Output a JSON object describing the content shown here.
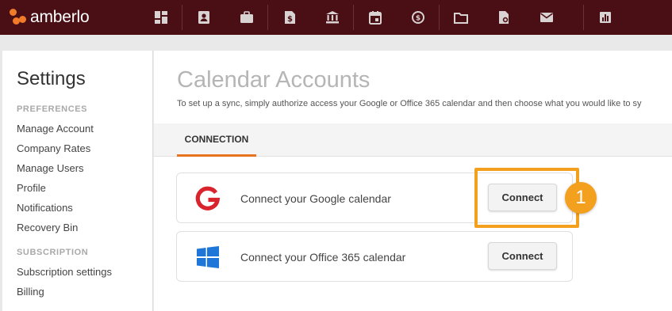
{
  "app": {
    "name": "amberlo"
  },
  "nav": [
    {
      "icon": "dashboard-icon"
    },
    {
      "icon": "contacts-icon"
    },
    {
      "icon": "matters-icon"
    },
    {
      "icon": "billing-icon"
    },
    {
      "icon": "bank-icon"
    },
    {
      "icon": "calendar-icon"
    },
    {
      "icon": "time-tracking-icon"
    },
    {
      "icon": "folder-icon"
    },
    {
      "icon": "document-icon"
    },
    {
      "icon": "mail-icon"
    },
    {
      "icon": "reports-icon"
    }
  ],
  "sidebar": {
    "title": "Settings",
    "preferences_label": "PREFERENCES",
    "preferences": [
      {
        "label": "Manage Account"
      },
      {
        "label": "Company Rates"
      },
      {
        "label": "Manage Users"
      },
      {
        "label": "Profile"
      },
      {
        "label": "Notifications"
      },
      {
        "label": "Recovery Bin"
      }
    ],
    "subscription_label": "SUBSCRIPTION",
    "subscription": [
      {
        "label": "Subscription settings"
      },
      {
        "label": "Billing"
      }
    ]
  },
  "main": {
    "title": "Calendar Accounts",
    "subtitle": "To set up a sync, simply authorize access your Google or Office 365 calendar and then choose what you would like to sy",
    "tab": "CONNECTION",
    "accounts": [
      {
        "icon": "google-icon",
        "text": "Connect your Google calendar",
        "button": "Connect"
      },
      {
        "icon": "windows-icon",
        "text": "Connect your Office 365 calendar",
        "button": "Connect"
      }
    ]
  },
  "annotation": {
    "step": "1"
  },
  "colors": {
    "topbar": "#4a0f14",
    "accent": "#e8731f",
    "highlight": "#f3a01e",
    "google_red": "#d9232d",
    "windows_blue": "#1e77d8"
  }
}
